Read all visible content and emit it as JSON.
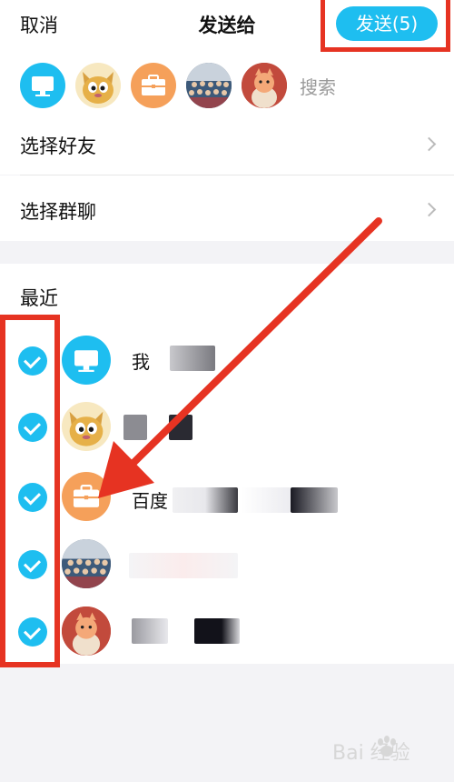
{
  "header": {
    "cancel_label": "取消",
    "title": "发送给",
    "send_label": "发送(5)"
  },
  "search": {
    "label": "搜索"
  },
  "selected_avatars": [
    "computer-avatar",
    "cat-avatar",
    "briefcase-avatar",
    "group-photo-avatar",
    "cartoon-avatar"
  ],
  "menu": {
    "select_friends": "选择好友",
    "select_groups": "选择群聊"
  },
  "recent": {
    "title": "最近",
    "contacts": [
      {
        "avatar": "computer-avatar",
        "name": "我",
        "checked": true
      },
      {
        "avatar": "cat-avatar",
        "name": "",
        "checked": true
      },
      {
        "avatar": "briefcase-avatar",
        "name": "百度",
        "checked": true
      },
      {
        "avatar": "group-photo-avatar",
        "name": "",
        "checked": true
      },
      {
        "avatar": "cartoon-avatar",
        "name": "",
        "checked": true
      }
    ]
  },
  "watermark": {
    "text": "Bai 经验"
  },
  "colors": {
    "accent": "#1ebef0",
    "highlight": "#e63322",
    "orange_avatar": "#f5a05a",
    "background": "#f3f3f6"
  }
}
